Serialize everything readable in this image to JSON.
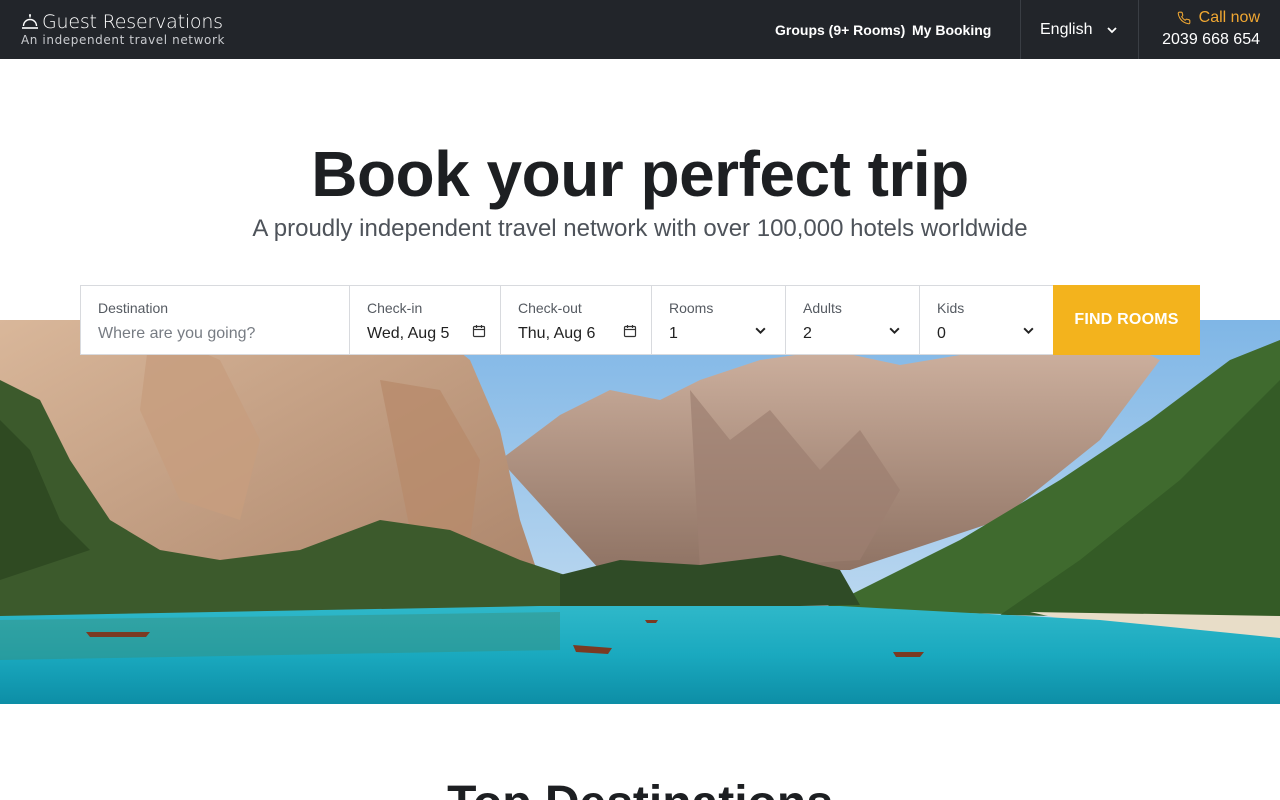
{
  "brand": {
    "name": "Guest Reservations",
    "tagline": "An independent travel network"
  },
  "nav": {
    "groups": "Groups (9+ Rooms)",
    "my_booking": "My Booking",
    "language": "English",
    "call_label": "Call now",
    "phone": "2039 668 654"
  },
  "hero": {
    "title": "Book your perfect trip",
    "subtitle": "A proudly independent travel network with over 100,000 hotels worldwide"
  },
  "search": {
    "destination": {
      "label": "Destination",
      "placeholder": "Where are you going?"
    },
    "checkin": {
      "label": "Check-in",
      "value": "Wed, Aug 5"
    },
    "checkout": {
      "label": "Check-out",
      "value": "Thu, Aug 6"
    },
    "rooms": {
      "label": "Rooms",
      "value": "1"
    },
    "adults": {
      "label": "Adults",
      "value": "2"
    },
    "kids": {
      "label": "Kids",
      "value": "0"
    },
    "button": "FIND ROOMS"
  },
  "sections": {
    "top_destinations": "Top Destinations"
  },
  "icons": {
    "brand": "bell-icon",
    "phone": "phone-icon",
    "calendar": "calendar-icon",
    "chevron": "chevron-down-icon"
  },
  "colors": {
    "header_bg": "#22252a",
    "accent": "#f3b31d",
    "call_text": "#f0a732"
  }
}
